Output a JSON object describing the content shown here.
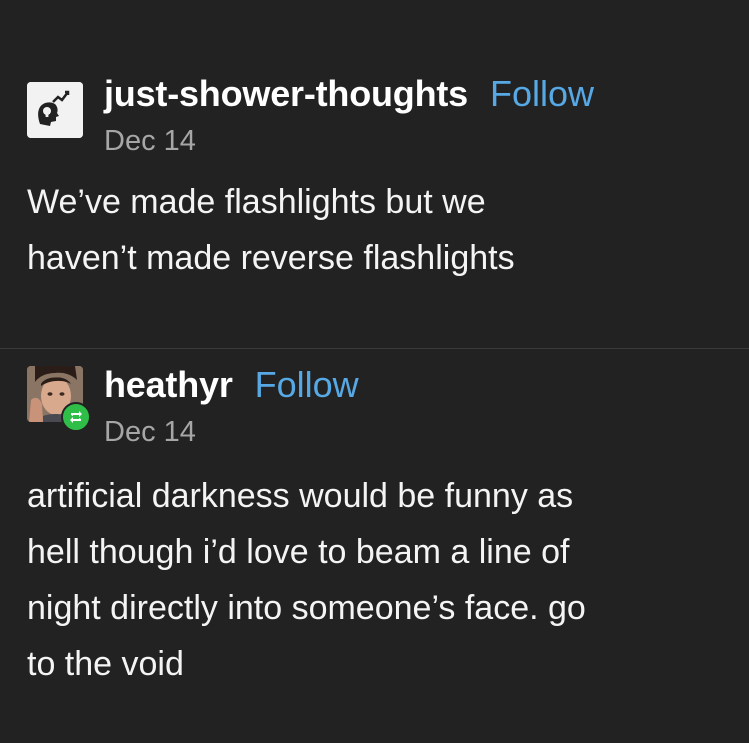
{
  "posts": [
    {
      "author": "just-shower-thoughts",
      "follow_label": "Follow",
      "date": "Dec 14",
      "body_lines": [
        "We’ve made flashlights but we",
        "haven’t made reverse flashlights"
      ],
      "avatar_icon": "head-with-lightbulb-chart-icon"
    },
    {
      "author": "heathyr",
      "follow_label": "Follow",
      "date": "Dec 14",
      "body_lines": [
        "artificial darkness would be funny as",
        "hell though i’d love to beam a line of",
        "night directly into someone’s face. go",
        "to the void"
      ],
      "avatar_icon": "profile-photo",
      "badge_icon": "reblog-icon"
    }
  ],
  "colors": {
    "background": "#222222",
    "text": "#ffffff",
    "follow_link": "#57a9e6",
    "date": "#a6a6a6",
    "reblog_badge": "#2fbf49"
  }
}
